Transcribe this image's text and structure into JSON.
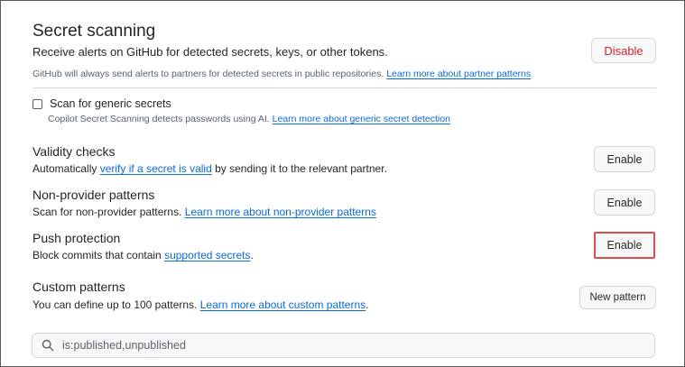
{
  "secret_scanning": {
    "title": "Secret scanning",
    "description": "Receive alerts on GitHub for detected secrets, keys, or other tokens.",
    "note": "GitHub will always send alerts to partners for detected secrets in public repositories.",
    "note_link": "Learn more about partner patterns",
    "disable_label": "Disable"
  },
  "generic_secrets": {
    "label": "Scan for generic secrets",
    "checked": false,
    "description": "Copilot Secret Scanning detects passwords using AI.",
    "link": "Learn more about generic secret detection"
  },
  "validity_checks": {
    "title": "Validity checks",
    "desc_before": "Automatically",
    "link": "verify if a secret is valid",
    "desc_after": "by sending it to the relevant partner.",
    "button_label": "Enable"
  },
  "non_provider": {
    "title": "Non-provider patterns",
    "description": "Scan for non-provider patterns.",
    "link": "Learn more about non-provider patterns",
    "button_label": "Enable"
  },
  "push_protection": {
    "title": "Push protection",
    "desc_before": "Block commits that contain",
    "link": "supported secrets",
    "button_label": "Enable"
  },
  "custom_patterns": {
    "title": "Custom patterns",
    "description": "You can define up to 100 patterns.",
    "link": "Learn more about custom patterns",
    "button_label": "New pattern"
  },
  "search": {
    "value": "is:published,unpublished",
    "icon": "search-icon"
  },
  "colors": {
    "link": "#0969da",
    "danger": "#d1242f",
    "highlight": "#e5484d"
  }
}
